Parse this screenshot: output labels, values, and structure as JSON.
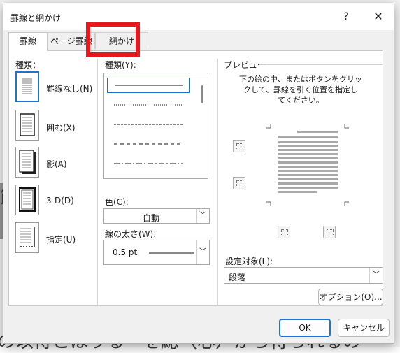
{
  "window": {
    "title": "罫線と網かけ",
    "help": "?",
    "close": "✕"
  },
  "tabs": [
    {
      "label": "罫線",
      "active": true
    },
    {
      "label": "ページ罫線"
    },
    {
      "label": "網かけ"
    }
  ],
  "settings": {
    "label": "種類：",
    "items": [
      {
        "label": "罫線なし(N)"
      },
      {
        "label": "囲む(X)"
      },
      {
        "label": "影(A)"
      },
      {
        "label": "3-D(D)"
      },
      {
        "label": "指定(U)"
      }
    ]
  },
  "style": {
    "label": "種類(Y):"
  },
  "color": {
    "label": "色(C):",
    "value": "自動"
  },
  "width": {
    "label": "線の太さ(W):",
    "value": "0.5 pt"
  },
  "preview": {
    "label": "プレビュー",
    "instructions": [
      "下の絵の中、またはボタンをクリッ",
      "クして、罫線を引く位置を指定し",
      "てください。"
    ]
  },
  "apply_to": {
    "label": "設定対象(L):",
    "value": "段落"
  },
  "buttons": {
    "options": "オプション(O)...",
    "ok": "OK",
    "cancel": "キャンセル"
  },
  "background_doc": {
    "glyph": "節",
    "bottom_text": "の以待とほりる　を総（心）から得られるの"
  }
}
